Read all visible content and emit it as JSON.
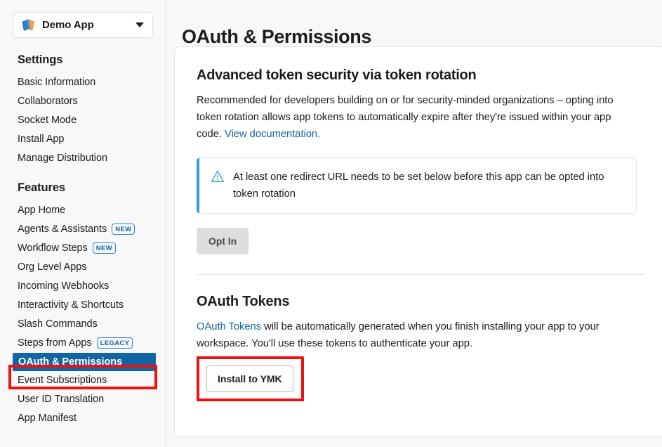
{
  "sidebar": {
    "app_switcher": {
      "app_name": "Demo App",
      "logo_icon": "app-book-icon",
      "caret_icon": "chevron-down-icon"
    },
    "groups": [
      {
        "heading": "Settings",
        "items": [
          {
            "label": "Basic Information",
            "badge": null,
            "active": false
          },
          {
            "label": "Collaborators",
            "badge": null,
            "active": false
          },
          {
            "label": "Socket Mode",
            "badge": null,
            "active": false
          },
          {
            "label": "Install App",
            "badge": null,
            "active": false
          },
          {
            "label": "Manage Distribution",
            "badge": null,
            "active": false
          }
        ]
      },
      {
        "heading": "Features",
        "items": [
          {
            "label": "App Home",
            "badge": null,
            "active": false
          },
          {
            "label": "Agents & Assistants",
            "badge": "NEW",
            "active": false
          },
          {
            "label": "Workflow Steps",
            "badge": "NEW",
            "active": false
          },
          {
            "label": "Org Level Apps",
            "badge": null,
            "active": false
          },
          {
            "label": "Incoming Webhooks",
            "badge": null,
            "active": false
          },
          {
            "label": "Interactivity & Shortcuts",
            "badge": null,
            "active": false
          },
          {
            "label": "Slash Commands",
            "badge": null,
            "active": false
          },
          {
            "label": "Steps from Apps",
            "badge": "LEGACY",
            "active": false
          },
          {
            "label": "OAuth & Permissions",
            "badge": null,
            "active": true
          },
          {
            "label": "Event Subscriptions",
            "badge": null,
            "active": false
          },
          {
            "label": "User ID Translation",
            "badge": null,
            "active": false
          },
          {
            "label": "App Manifest",
            "badge": null,
            "active": false
          }
        ]
      }
    ]
  },
  "main": {
    "page_title": "OAuth & Permissions",
    "token_rotation": {
      "title": "Advanced token security via token rotation",
      "body_before_link": "Recommended for developers building on or for security-minded organizations – opting into token rotation allows app tokens to automatically expire after they're issued within your app code. ",
      "link_text": "View documentation.",
      "alert": {
        "icon": "warning-triangle-icon",
        "text": "At least one redirect URL needs to be set below before this app can be opted into token rotation"
      },
      "opt_in_label": "Opt In"
    },
    "oauth_tokens": {
      "title": "OAuth Tokens",
      "link_text": "OAuth Tokens",
      "body_after_link": " will be automatically generated when you finish installing your app to your workspace. You'll use these tokens to authenticate your app.",
      "install_button_label": "Install to YMK"
    }
  },
  "annotations": {
    "color": "#ee1111",
    "targets": [
      "OAuth & Permissions",
      "Install to YMK"
    ]
  },
  "colors": {
    "accent_blue": "#1264a3",
    "alert_blue": "#2f9fd8",
    "sidebar_bg": "#f8f8f8",
    "annotation_red": "#ee1111"
  }
}
